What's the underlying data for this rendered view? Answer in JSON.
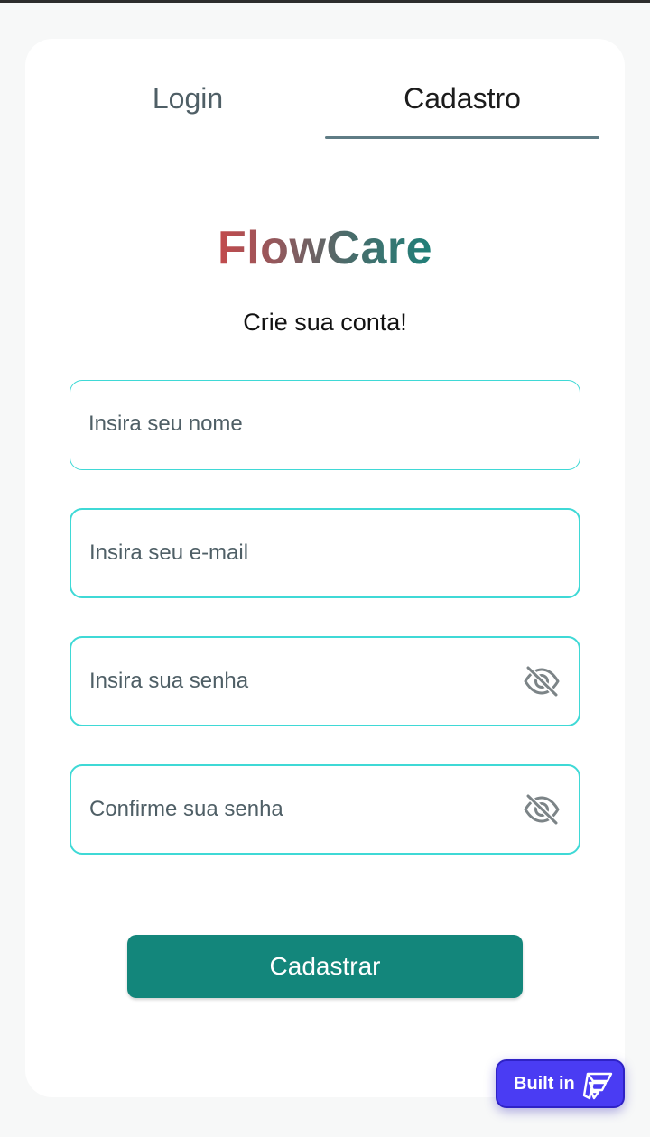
{
  "tabs": {
    "login": "Login",
    "cadastro": "Cadastro",
    "active": "cadastro"
  },
  "brand": {
    "name": "FlowCare",
    "gradient_colors": [
      "#c34a4c",
      "#1f8079"
    ]
  },
  "subtitle": "Crie sua conta!",
  "form": {
    "name_placeholder": "Insira seu nome",
    "email_placeholder": "Insira seu e-mail",
    "password_placeholder": "Insira sua senha",
    "confirm_placeholder": "Confirme sua senha",
    "toggle_icon": "eye-off-icon",
    "submit_label": "Cadastrar"
  },
  "badge": {
    "label": "Built in",
    "icon": "flutterflow-logo-icon"
  },
  "colors": {
    "accent": "#13867b",
    "field_border": "#3fd9d6",
    "badge": "#4a3cf3"
  }
}
